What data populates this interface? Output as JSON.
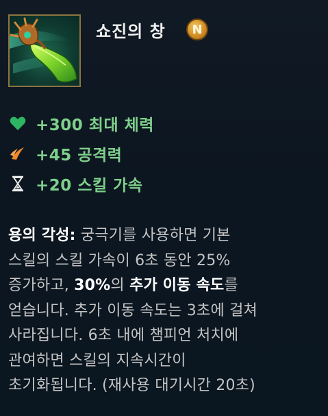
{
  "item": {
    "name": "쇼진의 창",
    "badge": "N",
    "icon": "shojin-spear-icon"
  },
  "stats": [
    {
      "icon": "heart-icon",
      "text": "+300 최대 체력",
      "color": "#2db563"
    },
    {
      "icon": "sword-claw-icon",
      "text": "+45 공격력",
      "color": "#f08a2a"
    },
    {
      "icon": "hourglass-icon",
      "text": "+20 스킬 가속",
      "color": "#e8e8e8"
    }
  ],
  "passive": {
    "line1_name": "용의 각성:",
    "line1_rest": " 궁극기를 사용하면 기본",
    "line2": "스킬의 스킬 가속이 6초 동안 25%",
    "line3_pre": "증가하고, ",
    "line3_hl1": "30%",
    "line3_mid": "의 ",
    "line3_hl2": "추가 이동 속도",
    "line3_post": "를",
    "line4": "얻습니다. 추가 이동 속도는 3초에 걸쳐",
    "line5": "사라집니다. 6초 내에 챔피언 처치에",
    "line6": "관여하면 스킬의 지속시간이",
    "line7": "초기화됩니다. (재사용 대기시간 20초)"
  },
  "colors": {
    "stat_text": "#7fd08c",
    "body_text": "#c4c4c4",
    "highlight": "#ffffff",
    "frame": "#8c7440",
    "badge": "#d08a22"
  }
}
